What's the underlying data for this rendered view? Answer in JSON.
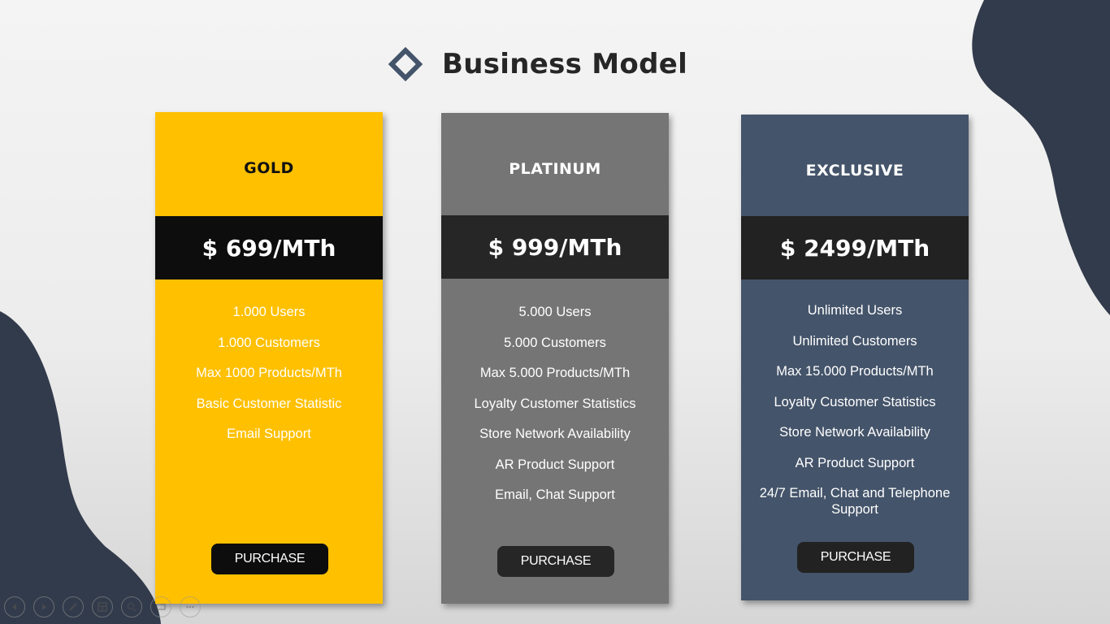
{
  "slide": {
    "title": "Business Model",
    "colors": {
      "gold": "#ffc000",
      "platinum": "#757575",
      "exclusive": "#44546a",
      "band_dark": "#0d0d0d",
      "blob": "#3a4557"
    }
  },
  "plans": [
    {
      "name": "GOLD",
      "price": "$ 699/MTh",
      "features": [
        "1.000 Users",
        "1.000 Customers",
        "Max 1000 Products/MTh",
        "Basic Customer Statistic",
        "Email Support"
      ],
      "button": "PURCHASE"
    },
    {
      "name": "PLATINUM",
      "price": "$ 999/MTh",
      "features": [
        "5.000 Users",
        "5.000 Customers",
        "Max 5.000 Products/MTh",
        "Loyalty Customer Statistics",
        "Store Network Availability",
        "AR Product Support",
        "Email, Chat Support"
      ],
      "button": "PURCHASE"
    },
    {
      "name": "EXCLUSIVE",
      "price": "$ 2499/MTh",
      "features": [
        "Unlimited Users",
        "Unlimited Customers",
        "Max 15.000 Products/MTh",
        "Loyalty Customer Statistics",
        "Store Network Availability",
        "AR Product Support",
        "24/7 Email, Chat and Telephone Support"
      ],
      "button": "PURCHASE"
    }
  ],
  "presenter_controls": [
    {
      "icon": "previous-slide-icon"
    },
    {
      "icon": "next-slide-icon"
    },
    {
      "icon": "pen-icon"
    },
    {
      "icon": "slide-sorter-icon"
    },
    {
      "icon": "zoom-icon"
    },
    {
      "icon": "subtitles-icon"
    },
    {
      "icon": "more-options-icon"
    }
  ]
}
